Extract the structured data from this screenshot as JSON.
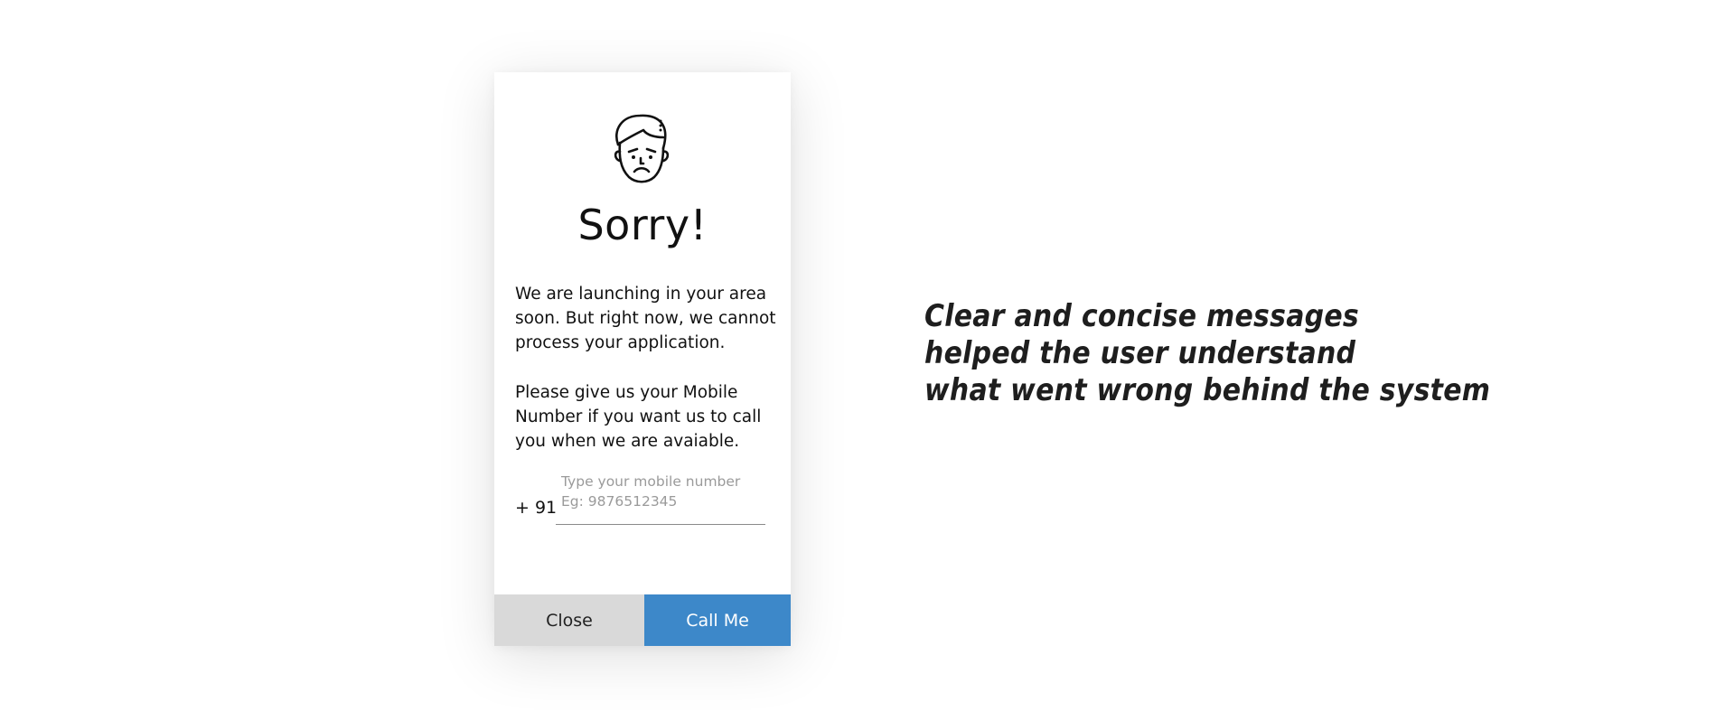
{
  "dialog": {
    "icon": "sad-face-icon",
    "title": "Sorry!",
    "message_1": "We are launching in your area soon. But right now, we cannot process your application.",
    "message_2": "Please give us your Mobile Number if you want us to call you when we are avaiable.",
    "phone": {
      "country_code": "+ 91",
      "label": "Type your mobile number",
      "placeholder": "Eg: 9876512345",
      "value": ""
    },
    "buttons": {
      "close_label": "Close",
      "call_label": "Call Me"
    }
  },
  "caption": {
    "line1": "Clear and concise messages",
    "line2": "helped the user understand",
    "line3": "what went wrong behind the system"
  },
  "colors": {
    "primary": "#3d88c9",
    "secondary_button": "#d9d9d9",
    "text": "#111111"
  }
}
